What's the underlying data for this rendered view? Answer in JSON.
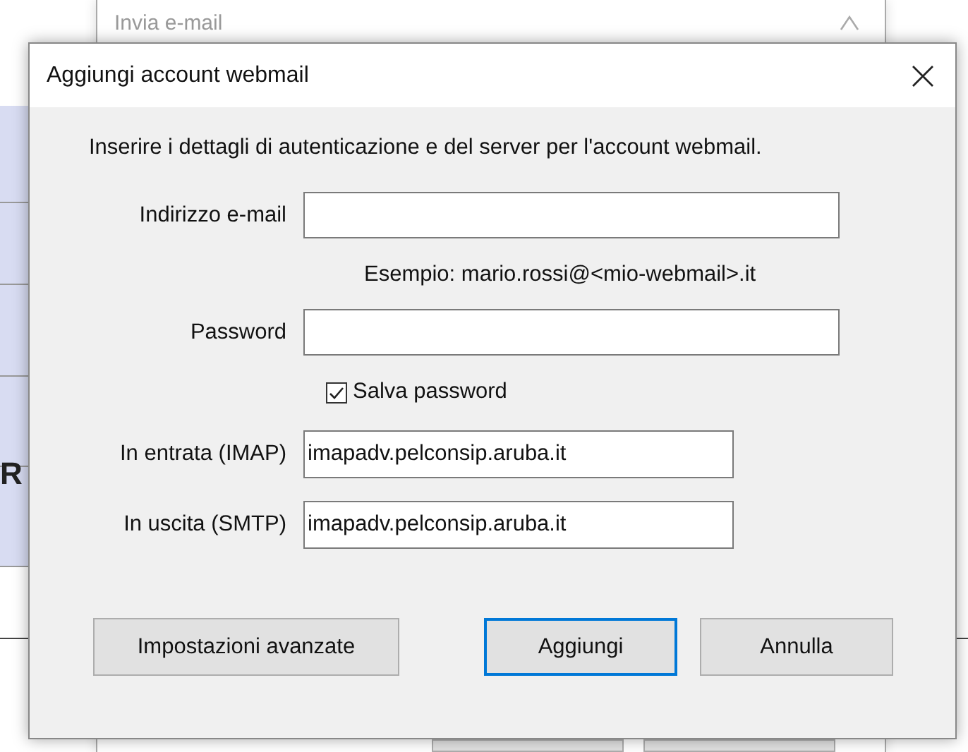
{
  "background_window": {
    "title": "Invia e-mail",
    "side_text": "R"
  },
  "dialog": {
    "title": "Aggiungi account webmail",
    "intro": "Inserire i dettagli di autenticazione e del server per l'account webmail.",
    "rows": [
      {
        "kind": "field",
        "label": "Indirizzo e-mail"
      },
      {
        "kind": "hint",
        "text": "Esempio: mario.rossi@<mio-webmail>.it"
      },
      {
        "kind": "field",
        "label": "Password"
      },
      {
        "kind": "checkbox",
        "label": "Salva password",
        "checked": true
      },
      {
        "kind": "server",
        "label": "In entrata (IMAP)",
        "value": "imapadv.pelconsip.aruba.it"
      },
      {
        "kind": "server",
        "label": "In uscita (SMTP)",
        "value": "imapadv.pelconsip.aruba.it"
      }
    ],
    "buttons": [
      {
        "label": "Impostazioni avanzate",
        "default": false
      },
      {
        "label": "Aggiungi",
        "default": true
      },
      {
        "label": "Annulla",
        "default": false
      }
    ]
  }
}
